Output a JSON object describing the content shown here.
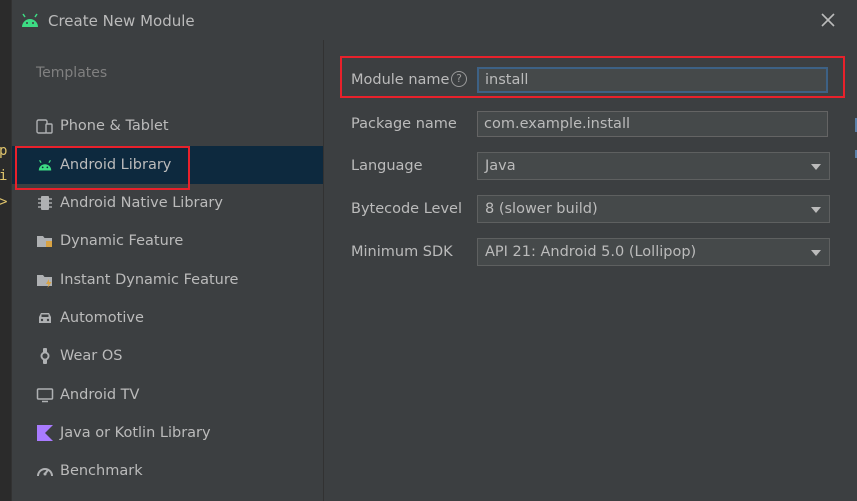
{
  "window": {
    "title": "Create New Module"
  },
  "templates": {
    "heading": "Templates",
    "items": [
      {
        "label": "Phone & Tablet",
        "icon": "phone-tablet-icon",
        "selected": false
      },
      {
        "label": "Android Library",
        "icon": "android-icon",
        "selected": true
      },
      {
        "label": "Android Native Library",
        "icon": "chip-icon",
        "selected": false
      },
      {
        "label": "Dynamic Feature",
        "icon": "folder-icon",
        "selected": false
      },
      {
        "label": "Instant Dynamic Feature",
        "icon": "folder-bolt-icon",
        "selected": false
      },
      {
        "label": "Automotive",
        "icon": "car-icon",
        "selected": false
      },
      {
        "label": "Wear OS",
        "icon": "watch-icon",
        "selected": false
      },
      {
        "label": "Android TV",
        "icon": "tv-icon",
        "selected": false
      },
      {
        "label": "Java or Kotlin Library",
        "icon": "kotlin-icon",
        "selected": false
      },
      {
        "label": "Benchmark",
        "icon": "gauge-icon",
        "selected": false
      }
    ]
  },
  "form": {
    "module_name": {
      "label": "Module name",
      "value": "install"
    },
    "package_name": {
      "label": "Package name",
      "value": "com.example.install"
    },
    "language": {
      "label": "Language",
      "value": "Java"
    },
    "bytecode_level": {
      "label": "Bytecode Level",
      "value": "8 (slower build)"
    },
    "minimum_sdk": {
      "label": "Minimum SDK",
      "value": "API 21: Android 5.0 (Lollipop)"
    }
  },
  "colors": {
    "accent_android": "#3ddc84",
    "highlight_red": "#e8212b",
    "selected_row": "#0d293e"
  }
}
